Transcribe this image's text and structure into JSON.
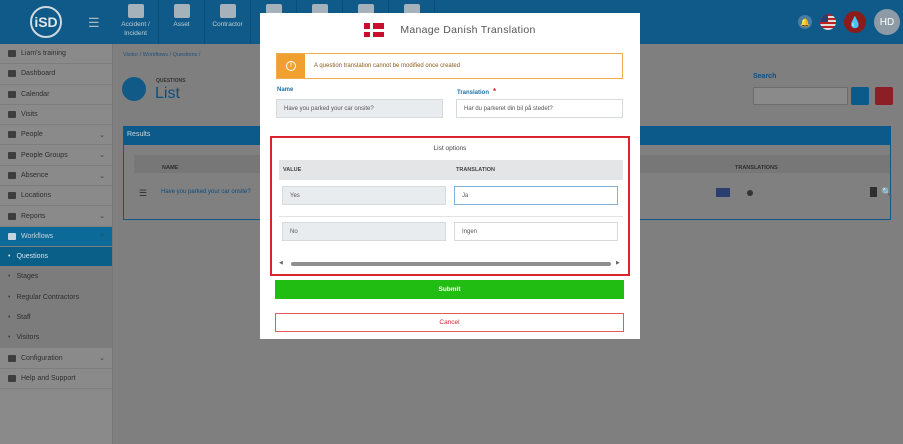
{
  "app": {
    "logo_text": "iSD"
  },
  "topnav": [
    {
      "label": "Accident / Incident",
      "icon": "first-aid-icon"
    },
    {
      "label": "Asset",
      "icon": "boxes-icon"
    },
    {
      "label": "Contractor",
      "icon": "hardhat-icon"
    },
    {
      "label": "",
      "icon": "wrench-icon"
    },
    {
      "label": "",
      "icon": "document-icon"
    },
    {
      "label": "",
      "icon": "user-icon"
    },
    {
      "label": "",
      "icon": "database-icon"
    }
  ],
  "user": {
    "initials": "HD"
  },
  "sidebar": {
    "items": [
      {
        "label": "Liam's training",
        "icon": "branch-icon",
        "chevron": false
      },
      {
        "label": "Dashboard",
        "icon": "dashboard-icon",
        "chevron": false
      },
      {
        "label": "Calendar",
        "icon": "calendar-icon",
        "chevron": false
      },
      {
        "label": "Visits",
        "icon": "visits-icon",
        "chevron": false
      },
      {
        "label": "People",
        "icon": "people-icon",
        "chevron": true
      },
      {
        "label": "People Groups",
        "icon": "people-groups-icon",
        "chevron": true
      },
      {
        "label": "Absence",
        "icon": "absence-icon",
        "chevron": true
      },
      {
        "label": "Locations",
        "icon": "locations-icon",
        "chevron": false
      },
      {
        "label": "Reports",
        "icon": "reports-icon",
        "chevron": true
      },
      {
        "label": "Workflows",
        "icon": "workflows-icon",
        "chevron": true
      }
    ],
    "sub_items": [
      "Questions",
      "Stages",
      "Regular Contractors",
      "Staff",
      "Visitors"
    ],
    "bottom_items": [
      {
        "label": "Configuration",
        "icon": "configuration-icon",
        "chevron": true
      },
      {
        "label": "Help and Support",
        "icon": "help-icon",
        "chevron": false
      }
    ]
  },
  "main": {
    "breadcrumb": "Visitor  /  Workflows  /  Questions  /",
    "page_subtitle": "QUESTIONS",
    "page_title": "List",
    "search_label": "Search",
    "results_label": "Results",
    "table": {
      "col_name": "NAME",
      "col_translations": "TRANSLATIONS",
      "row_name": "Have you parked your car onsite?"
    }
  },
  "modal": {
    "title": "Manage  Danish  Translation",
    "alert": "A question translation cannot be modified once created",
    "name_label": "Name",
    "name_value": "Have you parked your car onsite?",
    "translation_label": "Translation",
    "required_mark": "*",
    "translation_value": "Har du parkeret din bil på stedet?",
    "list_options_title": "List options",
    "col_value": "VALUE",
    "col_translation": "TRANSLATION",
    "options": [
      {
        "value": "Yes",
        "translation": "Ja"
      },
      {
        "value": "No",
        "translation": "Ingen"
      }
    ],
    "submit_label": "Submit",
    "cancel_label": "Cancel"
  },
  "colors": {
    "primary": "#0f5a88",
    "submit": "#22bd12",
    "danger": "#d9232d",
    "warning": "#f0ad4e"
  }
}
